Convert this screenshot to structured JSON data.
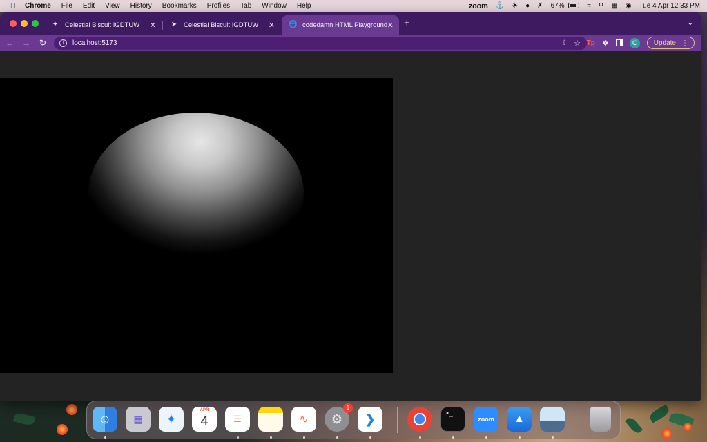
{
  "menubar": {
    "app": "Chrome",
    "items": [
      "File",
      "Edit",
      "View",
      "History",
      "Bookmarks",
      "Profiles",
      "Tab",
      "Window",
      "Help"
    ],
    "zoom": "zoom",
    "battery": "67%",
    "datetime": "Tue 4 Apr  12:33 PM"
  },
  "browser": {
    "tabs": [
      {
        "title": "Celestial Biscuit IGDTUW",
        "icon": "rocket-icon"
      },
      {
        "title": "Celestial Biscuit IGDTUW",
        "icon": "rocket-icon"
      },
      {
        "title": "codedamn HTML Playground",
        "icon": "globe-icon"
      }
    ],
    "active_tab": 2,
    "url": "localhost:5173",
    "update_label": "Update",
    "profile_initial": "C",
    "colors": {
      "frame": "#3e1b60",
      "toolbar": "#6a3a92",
      "omnibox": "#4c1f72"
    }
  },
  "dock": {
    "calendar_month": "APR",
    "calendar_day": "4",
    "settings_badge": "1",
    "zoom_label": "zoom",
    "terminal_prompt": ">_",
    "apps": [
      "Finder",
      "Launchpad",
      "Safari",
      "Calendar",
      "Reminders",
      "Notes",
      "Freeform",
      "System Settings",
      "Visual Studio Code",
      "Google Chrome",
      "Terminal",
      "zoom.us",
      "Keynote",
      "Preview",
      "Trash"
    ]
  }
}
